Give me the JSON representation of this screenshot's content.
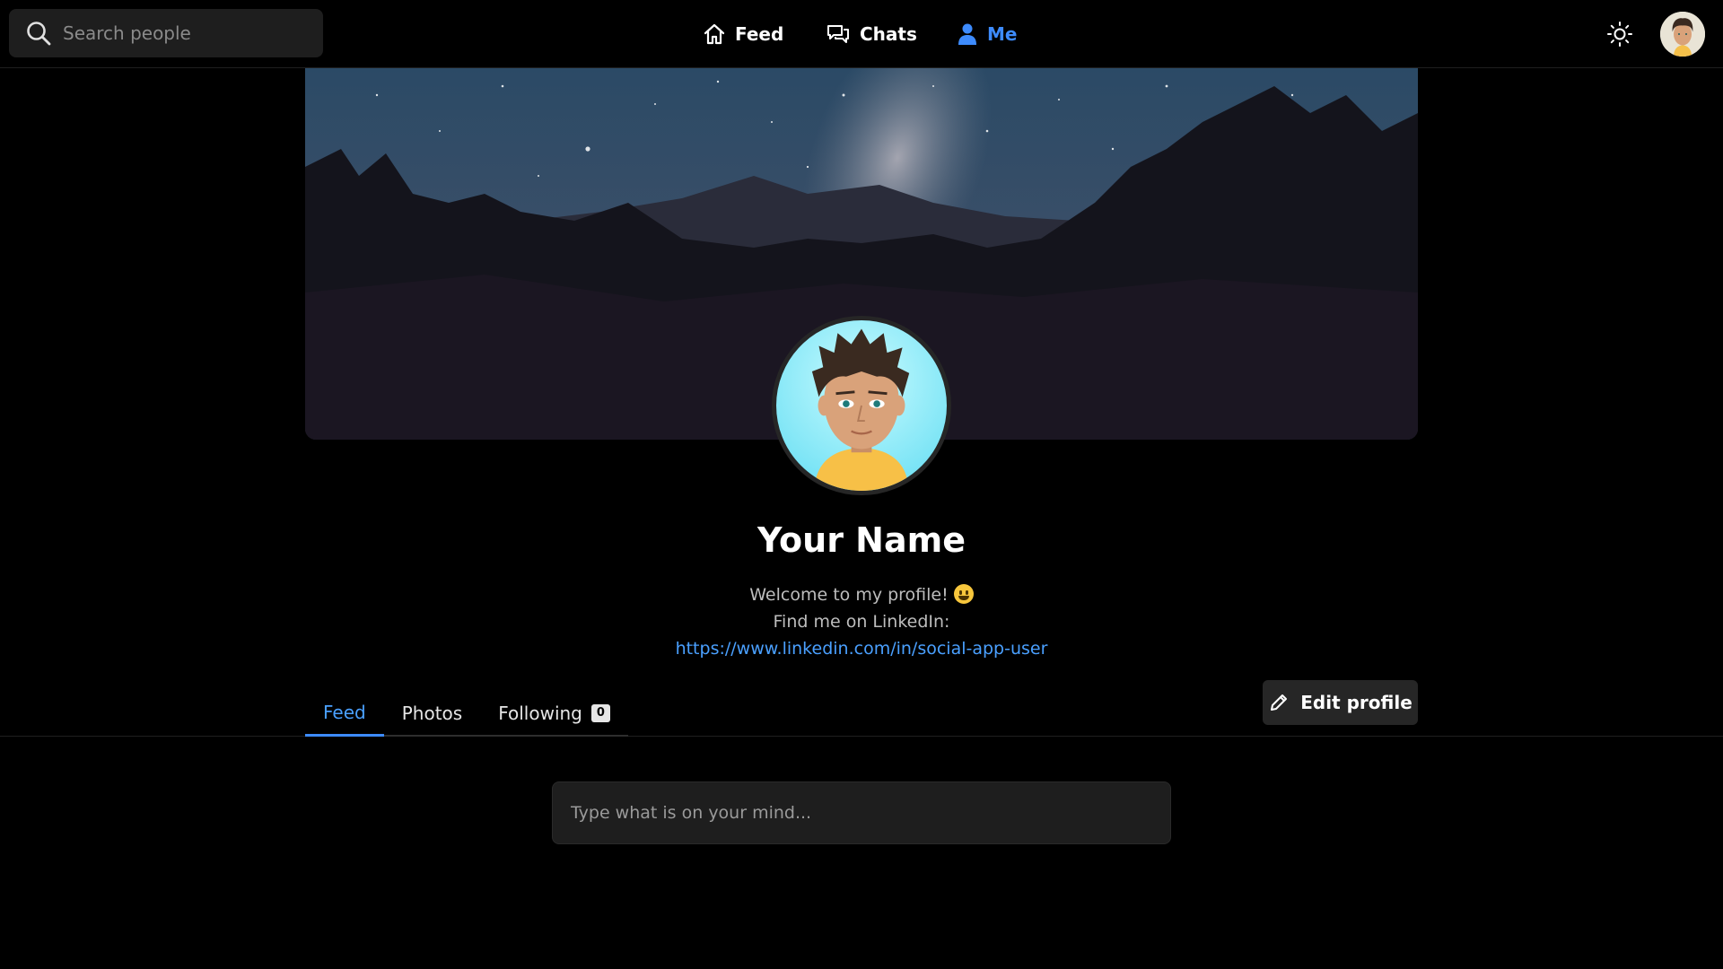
{
  "search": {
    "placeholder": "Search people",
    "icon": "search-icon"
  },
  "nav": {
    "feed_label": "Feed",
    "chats_label": "Chats",
    "me_label": "Me",
    "active": "Me",
    "accent_color": "#3d8bfd"
  },
  "header_icons": {
    "theme": "sun-icon",
    "avatar": "avatar"
  },
  "profile": {
    "name": "Your Name",
    "bio_line1": "Welcome to my profile!",
    "bio_line2_prefix": "Find me on LinkedIn:",
    "linkedin_url": "https://www.linkedin.com/in/social-app-user"
  },
  "tabs": {
    "feed": "Feed",
    "photos": "Photos",
    "following": "Following",
    "following_count": "0",
    "active": "Feed"
  },
  "edit_profile_label": "Edit profile",
  "composer": {
    "placeholder": "Type what is on your mind..."
  }
}
